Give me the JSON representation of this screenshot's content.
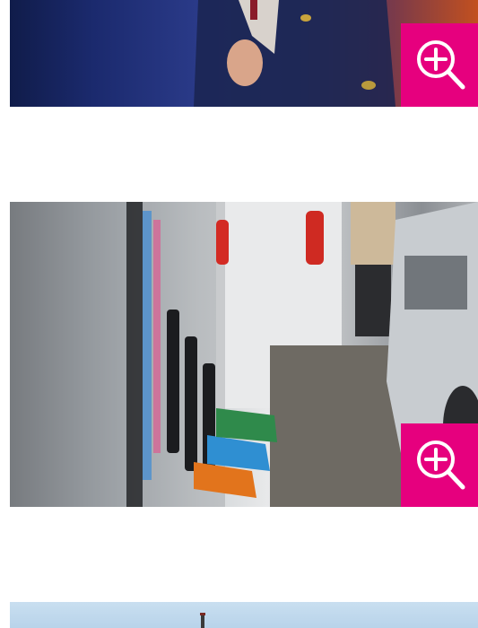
{
  "images": [
    {
      "id": "image-1",
      "zoom_icon": "zoom-in-icon"
    },
    {
      "id": "image-2",
      "zoom_icon": "zoom-in-icon"
    },
    {
      "id": "image-3"
    }
  ],
  "colors": {
    "accent": "#e6007e",
    "icon": "#ffffff",
    "background": "#ffffff"
  }
}
